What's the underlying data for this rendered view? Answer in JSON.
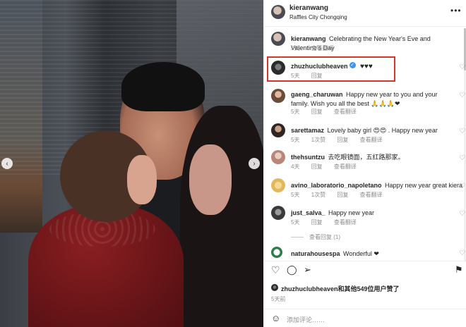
{
  "post": {
    "author": "kieranwang",
    "location": "Raffles City Chongqing",
    "more_icon": "more-horizontal-icon"
  },
  "caption": {
    "user": "kieranwang",
    "text": "Celebrating the New Year's Eve and Valentine's Day",
    "time": "5天",
    "translate": "查看翻译"
  },
  "comments": [
    {
      "user": "zhuzhuclubheaven",
      "verified": true,
      "text": "♥♥♥",
      "time": "5天",
      "action1": "回复",
      "action2": ""
    },
    {
      "user": "gaeng_charuwan",
      "text": "Happy new year to you and your family. Wish you all the best 🙏🙏🙏❤",
      "time": "5天",
      "action1": "回复",
      "action2": "查看翻译"
    },
    {
      "user": "sarettamaz",
      "text": "Lovely baby girl 😍😍 . Happy new year",
      "time": "5天",
      "action1": "1次赞",
      "action2": "回复",
      "action3": "查看翻译"
    },
    {
      "user": "thehsuntzu",
      "text": "去吃眼镜面，五红路那家。",
      "time": "4天",
      "action1": "回复",
      "action2": "查看翻译"
    },
    {
      "user": "avino_laboratorio_napoletano",
      "text": "Happy new year great kiera",
      "time": "5天",
      "action1": "1次赞",
      "action2": "回复",
      "action3": "查看翻译"
    },
    {
      "user": "just_salva_",
      "text": "Happy new year",
      "time": "5天",
      "action1": "回复",
      "action2": "查看翻译"
    },
    {
      "user": "naturahousespa",
      "text": "Wonderful ❤",
      "time": "",
      "action1": "",
      "action2": ""
    }
  ],
  "view_replies": "查看回复 (1)",
  "likes_text": "zhuzhuclubheaven和其他549位用户赞了",
  "posted_ago": "5天前",
  "add_comment_placeholder": "添加评论……",
  "icons": {
    "like": "heart-outline-icon",
    "comment": "comment-bubble-icon",
    "share": "paper-plane-icon",
    "save": "bookmark-icon",
    "emoji": "smiley-icon",
    "prev": "chevron-left-icon",
    "next": "chevron-right-icon"
  }
}
